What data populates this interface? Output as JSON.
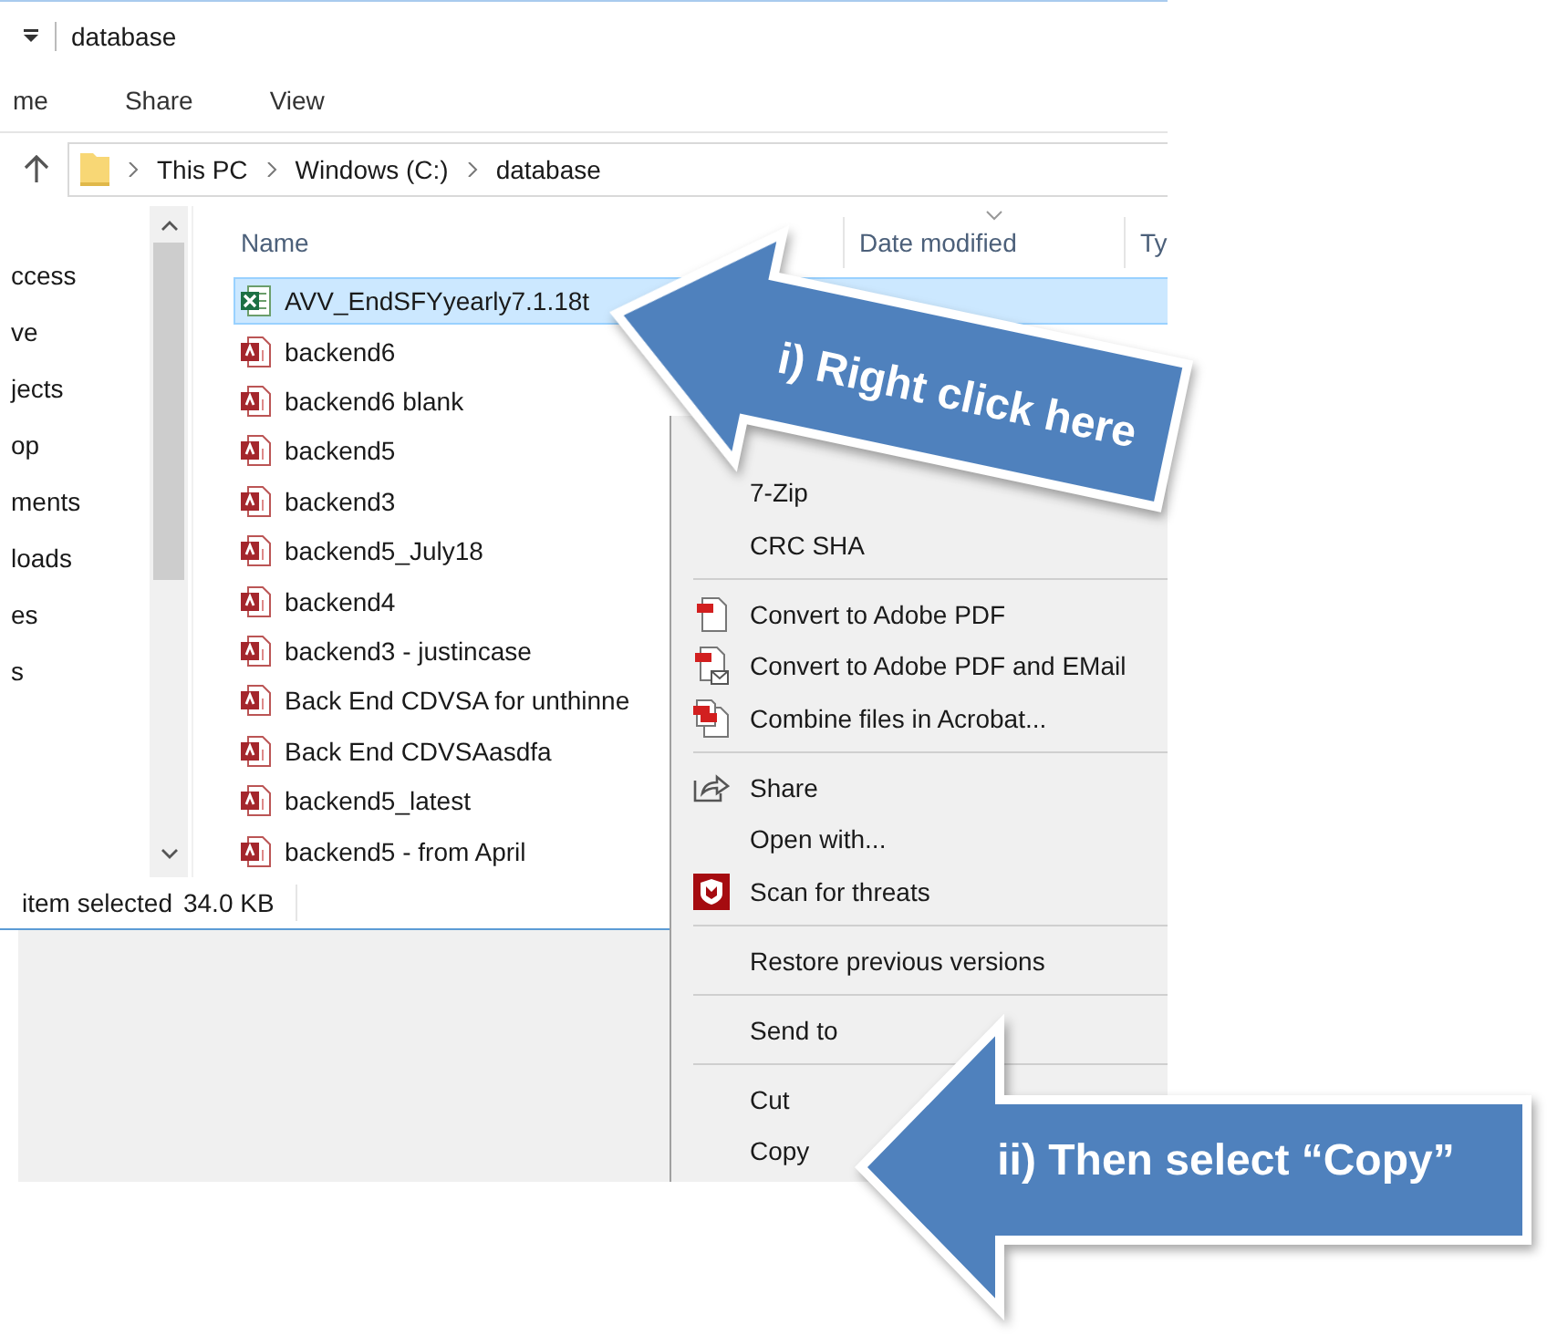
{
  "window": {
    "title": "database"
  },
  "ribbon_tabs": [
    "me",
    "Share",
    "View"
  ],
  "breadcrumbs": [
    "This PC",
    "Windows (C:)",
    "database"
  ],
  "nav_items": [
    "ccess",
    "ve",
    "jects",
    "op",
    "ments",
    "loads",
    "es",
    "s"
  ],
  "columns": [
    "Name",
    "Date modified",
    "Ty"
  ],
  "files": [
    {
      "name": "AVV_EndSFYyearly7.1.18t",
      "kind": "excel",
      "selected": true
    },
    {
      "name": "backend6",
      "kind": "access",
      "selected": false
    },
    {
      "name": "backend6  blank",
      "kind": "access",
      "selected": false
    },
    {
      "name": "backend5",
      "kind": "access",
      "selected": false
    },
    {
      "name": "backend3",
      "kind": "access",
      "selected": false
    },
    {
      "name": "backend5_July18",
      "kind": "access",
      "selected": false
    },
    {
      "name": "backend4",
      "kind": "access",
      "selected": false
    },
    {
      "name": "backend3 - justincase",
      "kind": "access",
      "selected": false
    },
    {
      "name": "Back End CDVSA for unthinne",
      "kind": "access",
      "selected": false
    },
    {
      "name": "Back End CDVSAasdfa",
      "kind": "access",
      "selected": false
    },
    {
      "name": "backend5_latest",
      "kind": "access",
      "selected": false
    },
    {
      "name": "backend5 - from April",
      "kind": "access",
      "selected": false
    }
  ],
  "status_bar": {
    "selection": "item selected",
    "size": "34.0 KB"
  },
  "context_menu": [
    {
      "kind": "plain",
      "label": "7-Zip"
    },
    {
      "kind": "plain",
      "label": "CRC SHA"
    },
    {
      "kind": "separator"
    },
    {
      "kind": "acrobat",
      "label": "Convert to Adobe PDF"
    },
    {
      "kind": "acrobat-mail",
      "label": "Convert to Adobe PDF and EMail"
    },
    {
      "kind": "acrobat-combine",
      "label": "Combine files in Acrobat..."
    },
    {
      "kind": "separator"
    },
    {
      "kind": "share",
      "label": "Share"
    },
    {
      "kind": "plain",
      "label": "Open with..."
    },
    {
      "kind": "shield",
      "label": "Scan for threats"
    },
    {
      "kind": "separator"
    },
    {
      "kind": "plain",
      "label": "Restore previous versions"
    },
    {
      "kind": "separator"
    },
    {
      "kind": "plain",
      "label": "Send to"
    },
    {
      "kind": "separator"
    },
    {
      "kind": "plain",
      "label": "Cut"
    },
    {
      "kind": "plain",
      "label": "Copy"
    }
  ],
  "callouts": [
    {
      "text": "i) Right click here"
    },
    {
      "text": "ii) Then select “Copy”"
    }
  ]
}
